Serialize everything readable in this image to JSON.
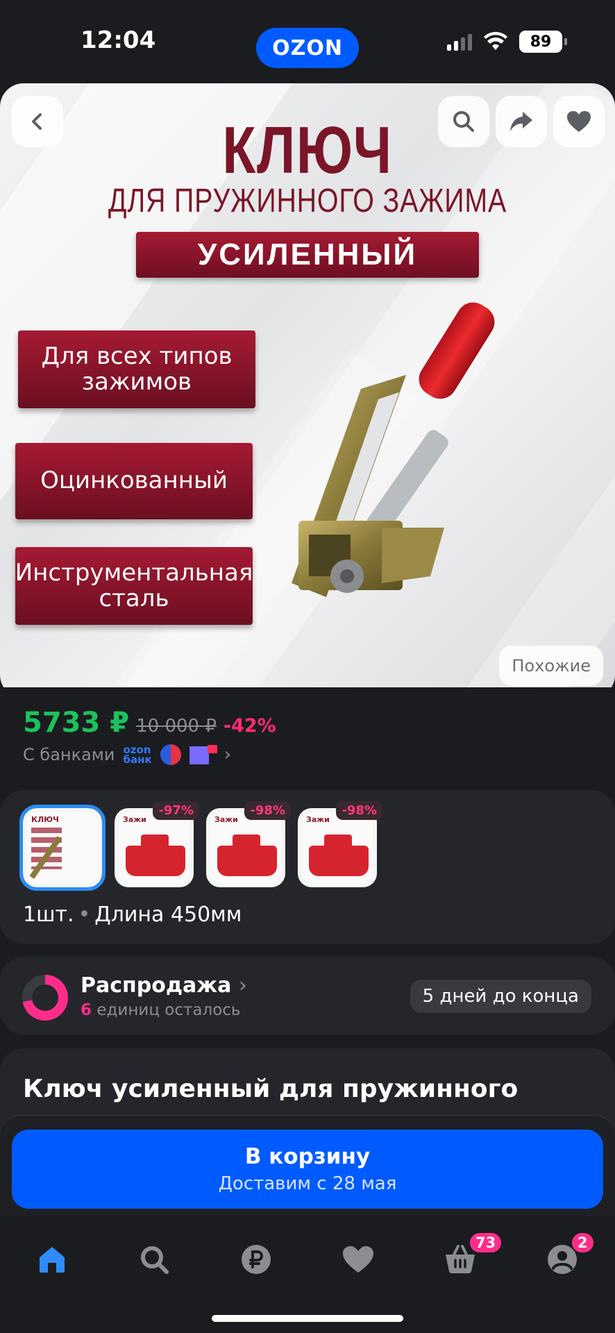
{
  "status_bar": {
    "time": "12:04",
    "brand": "OZON",
    "battery": "89"
  },
  "hero": {
    "title": "КЛЮЧ",
    "subtitle": "ДЛЯ ПРУЖИННОГО ЗАЖИМА",
    "banner": "УСИЛЕННЫЙ",
    "features": [
      "Для всех типов зажимов",
      "Оцинкованный",
      "Инструментальная сталь"
    ],
    "similar_label": "Похожие"
  },
  "price": {
    "current": "5733 ₽",
    "old": "10 000 ₽",
    "discount": "-42%",
    "banks_label": "С банками",
    "ozon_bank_line1": "ozon",
    "ozon_bank_line2": "банк"
  },
  "variants": {
    "thumb_title": "КЛЮЧ",
    "thumbs": [
      {
        "selected": true,
        "badge": "",
        "mini": "ДЛЯ ПРУЖИННОГО ЗАЖИМА"
      },
      {
        "selected": false,
        "badge": "-97%",
        "mini": "Зажи"
      },
      {
        "selected": false,
        "badge": "-98%",
        "mini": "Зажи"
      },
      {
        "selected": false,
        "badge": "-98%",
        "mini": "Зажи"
      }
    ],
    "quantity": "1шт.",
    "length": "Длина 450мм"
  },
  "sale": {
    "title": "Распродажа",
    "count": "6",
    "remaining": "единиц осталось",
    "deadline": "5 дней до конца"
  },
  "product": {
    "title": "Ключ усиленный для пружинного"
  },
  "cart": {
    "label": "В корзину",
    "delivery": "Доставим с 28 мая"
  },
  "tabbar": {
    "active_color": "#2f8cff",
    "cart_badge": "73",
    "profile_badge": "2"
  }
}
